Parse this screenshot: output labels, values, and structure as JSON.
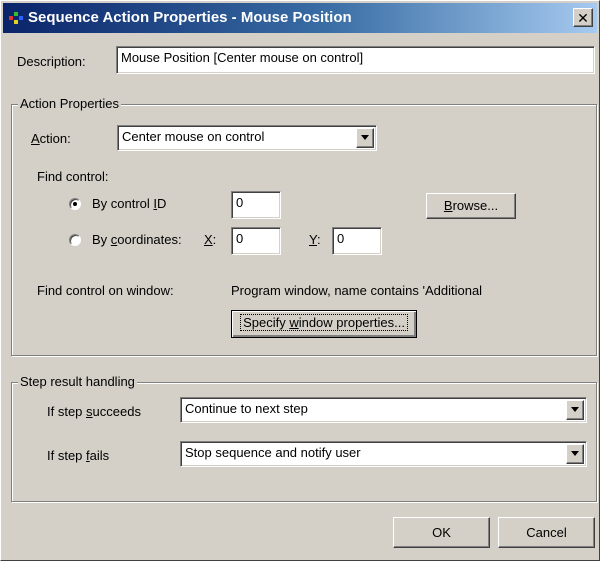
{
  "window": {
    "title": "Sequence Action Properties - Mouse Position",
    "close_glyph": "✕"
  },
  "description": {
    "label": "Description:",
    "value": "Mouse Position [Center mouse on control]"
  },
  "action_properties": {
    "group_title": "Action Properties",
    "action_label_pre": "",
    "action_label_key": "A",
    "action_label_post": "ction:",
    "action_value": "Center mouse on control",
    "find_control_label": "Find control:",
    "by_control_id": {
      "label_pre": "By control ",
      "label_key": "I",
      "label_post": "D",
      "checked": true,
      "value": "0"
    },
    "by_coordinates": {
      "label_pre": "By ",
      "label_key": "c",
      "label_post": "oordinates:",
      "checked": false,
      "x_label_key": "X",
      "x_label_post": ":",
      "x_value": "0",
      "y_label_key": "Y",
      "y_label_post": ":",
      "y_value": "0"
    },
    "browse_button": {
      "pre": "",
      "key": "B",
      "post": "rowse..."
    },
    "find_on_window_label": "Find control on window:",
    "find_on_window_value": "Program window, name contains 'Additional",
    "specify_button": {
      "pre": "Specify ",
      "key": "w",
      "post": "indow properties..."
    }
  },
  "step_result": {
    "group_title": "Step result handling",
    "succeeds_label_pre": "If step ",
    "succeeds_label_key": "s",
    "succeeds_label_post": "ucceeds",
    "succeeds_value": "Continue to next step",
    "fails_label_pre": "If step ",
    "fails_label_key": "f",
    "fails_label_post": "ails",
    "fails_value": "Stop sequence and notify user"
  },
  "footer": {
    "ok_label": "OK",
    "cancel_label": "Cancel"
  },
  "icons": {
    "app": "app-icon",
    "close": "close-icon",
    "dropdown": "chevron-down-icon"
  }
}
